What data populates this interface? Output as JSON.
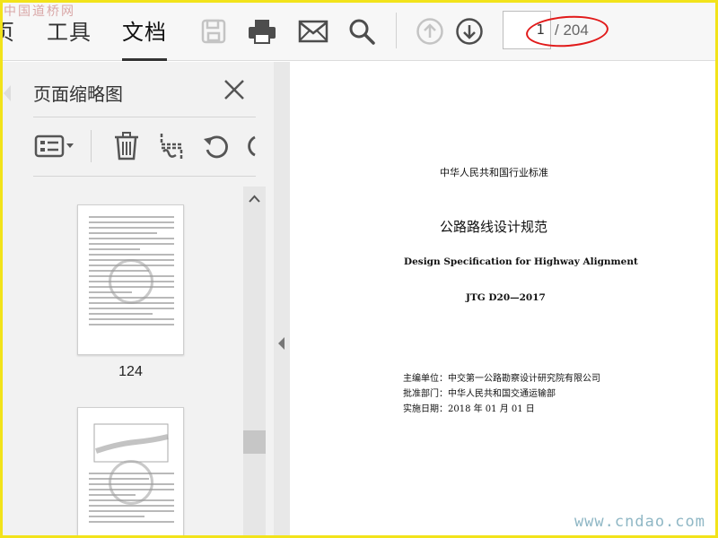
{
  "watermarks": {
    "top": "中国道桥网",
    "bottom": "www.cndao.com"
  },
  "toolbar": {
    "tabs": [
      {
        "label": "页"
      },
      {
        "label": "工具"
      },
      {
        "label": "文档"
      }
    ],
    "buttons": [
      "save-icon",
      "print-icon",
      "email-icon",
      "search-icon",
      "page-up-icon",
      "page-down-icon"
    ],
    "page_input_value": "1",
    "page_total": "/ 204",
    "highlight_color": "#e11a1a"
  },
  "thumbnail_pane": {
    "title": "页面缩略图",
    "buttons": [
      "thumbnail-options-icon",
      "delete-icon",
      "extract-icon",
      "rotate-icon"
    ],
    "thumbnails": [
      {
        "label": "124"
      }
    ]
  },
  "document": {
    "nation_standard": "中华人民共和国行业标准",
    "title_cn": "公路路线设计规范",
    "title_en": "Design Specification for Highway Alignment",
    "code": "JTG  D20—2017",
    "organization": "主编单位：中交第一公路勘察设计研究院有限公司",
    "approver": "批准部门：中华人民共和国交通运输部",
    "effective_date": "实施日期：2018 年 01 月 01 日"
  },
  "colors": {
    "frame": "#f2e31a",
    "toolbar_bg": "#f7f7f7",
    "pane_bg": "#f2f2f2"
  }
}
